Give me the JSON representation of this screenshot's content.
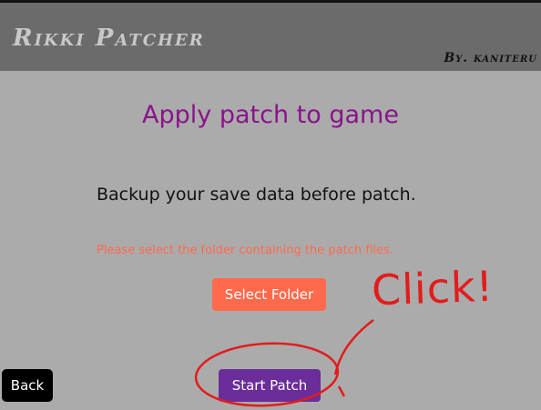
{
  "header": {
    "title": "Rikki Patcher",
    "author": "By. kaniteru"
  },
  "main": {
    "heading": "Apply patch to game",
    "notice": "Backup your save data before patch.",
    "hint": "Please select the folder containing the patch files.",
    "select_folder_label": "Select Folder",
    "start_patch_label": "Start Patch",
    "back_label": "Back"
  },
  "annotation": {
    "text": "Click!",
    "color": "#e31b1b"
  },
  "colors": {
    "background": "#ababab",
    "header": "#6b6b6b",
    "heading": "#8a138a",
    "select_button": "#ff6a4d",
    "start_button": "#6b2d9a",
    "back_button": "#000000"
  }
}
